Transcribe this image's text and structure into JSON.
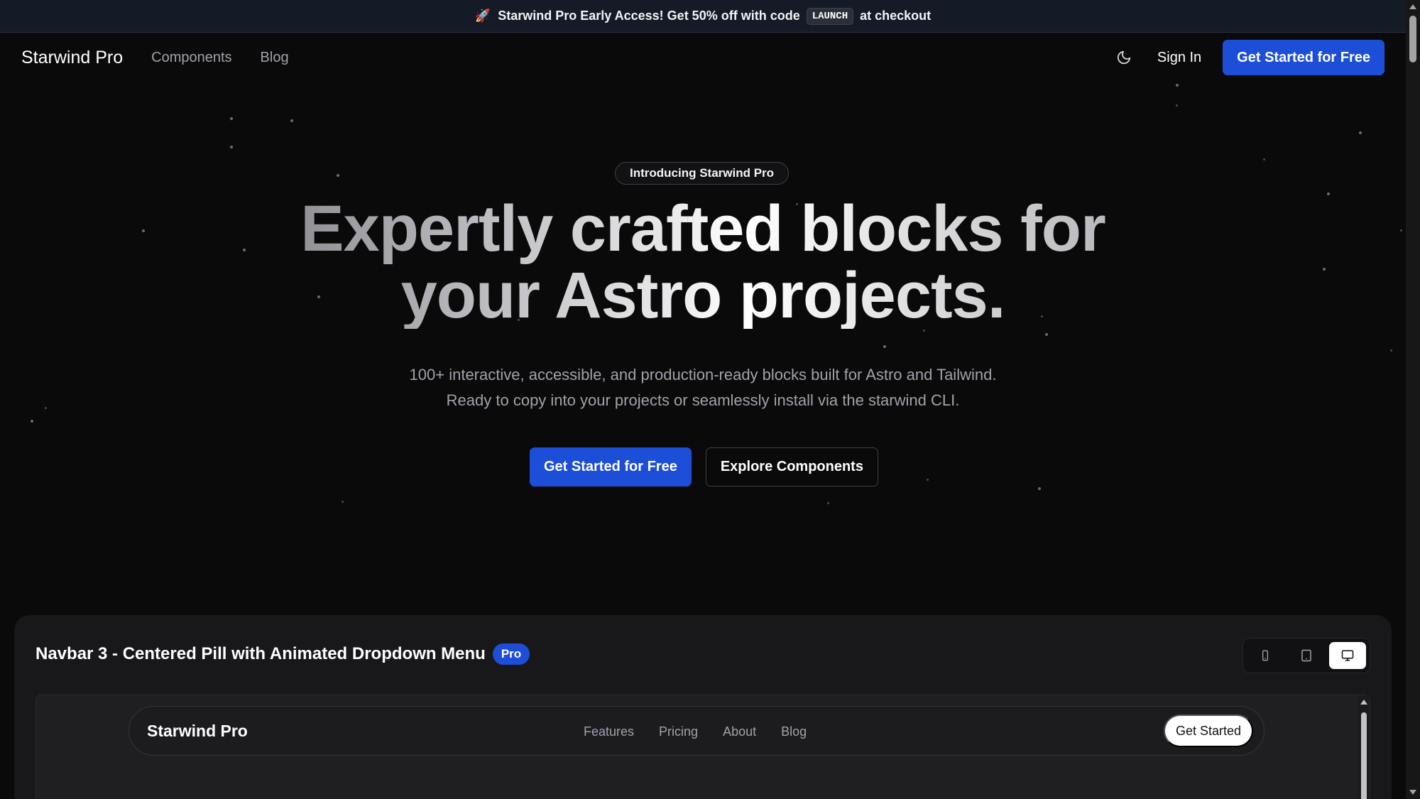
{
  "announcement": {
    "rocket": "🚀",
    "text_before": "Starwind Pro Early Access! Get 50% off with code",
    "code": "LAUNCH",
    "text_after": "at checkout"
  },
  "header": {
    "brand": "Starwind Pro",
    "nav": [
      "Components",
      "Blog"
    ],
    "theme_icon": "moon-icon",
    "sign_in": "Sign In",
    "cta": "Get Started for Free"
  },
  "hero": {
    "badge": "Introducing Starwind Pro",
    "title_line1": "Expertly crafted blocks for",
    "title_line2": "your Astro projects.",
    "subtitle_line1": "100+ interactive, accessible, and production-ready blocks built for Astro and Tailwind.",
    "subtitle_line2": "Ready to copy into your projects or seamlessly install via the starwind CLI.",
    "primary_cta": "Get Started for Free",
    "secondary_cta": "Explore Components"
  },
  "showcase": {
    "title": "Navbar 3 - Centered Pill with Animated Dropdown Menu",
    "badge": "Pro",
    "devices": [
      "mobile-icon",
      "tablet-icon",
      "desktop-icon"
    ],
    "active_device": "desktop-icon",
    "preview": {
      "brand": "Starwind Pro",
      "links": [
        "Features",
        "Pricing",
        "About",
        "Blog"
      ],
      "cta": "Get Started"
    }
  },
  "colors": {
    "background": "#0a0a0b",
    "accent": "#1d4ed8",
    "announcement_bg": "#141a26"
  }
}
